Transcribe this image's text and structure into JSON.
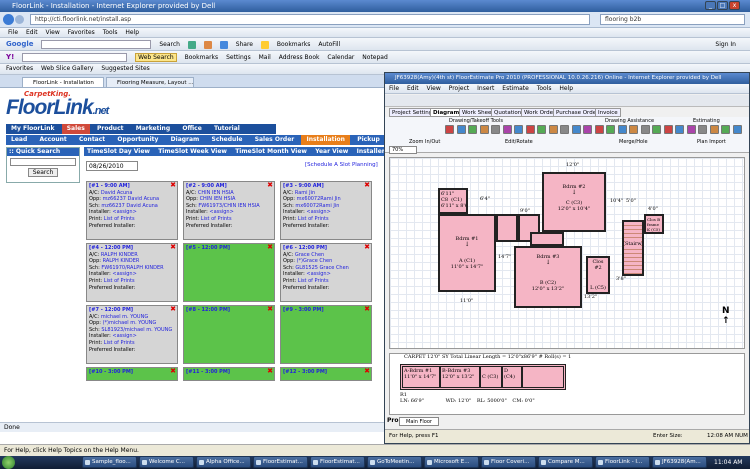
{
  "ie": {
    "title": "FloorLink - Installation - Internet Explorer provided by Dell",
    "url": "http://cti.floorlink.net/install.asp",
    "search_box": "flooring b2b",
    "menu": [
      "File",
      "Edit",
      "View",
      "Favorites",
      "Tools",
      "Help"
    ],
    "google_bar": {
      "logo": "Google",
      "search": "Search",
      "share": "Share",
      "bookmarks": "Bookmarks",
      "autofill": "AutoFill",
      "sign_in": "Sign In"
    },
    "yahoo_bar": {
      "web_search": "Web Search",
      "bookmarks": "Bookmarks",
      "settings": "Settings",
      "mail": "Mail",
      "address_book": "Address Book",
      "calendar": "Calendar",
      "notepad": "Notepad"
    },
    "fav_bar": {
      "favorites": "Favorites",
      "gallery": "Web Slice Gallery",
      "suggested": "Suggested Sites"
    },
    "tabs": [
      "FloorLink - Installation",
      "Flooring Measure, Layout ..."
    ],
    "status": "Done",
    "help": "For Help, click Help Topics on the Help Menu."
  },
  "floorlink": {
    "logo_top": "CarpetKing.",
    "logo_main": "FloorLink",
    "logo_suffix": ".net",
    "nav1": [
      "My FloorLink",
      "Sales",
      "Product",
      "Marketing",
      "Office",
      "Tutorial"
    ],
    "nav2": [
      "Lead",
      "Account",
      "Contact",
      "Opportunity",
      "Diagram",
      "Schedule",
      "Sales Order",
      "Installation",
      "Pickup",
      "Phone Log"
    ],
    "quick_search": "Quick Search",
    "search_button": "Search",
    "views": [
      "TimeSlot Day View",
      "TimeSlot Week View",
      "TimeSlot Month View",
      "Year View",
      "Installer"
    ],
    "date": "08/26/2010",
    "schedule_link": "[Schedule A Slot Planning]",
    "labels": {
      "ac": "A/C:",
      "opp": "Opp:",
      "sch": "Sch:",
      "installer": "Installer:",
      "assign": "<assign>",
      "print": "Print:",
      "print_value": "List of Prints",
      "preferred": "Preferred Installer:"
    },
    "slots": [
      {
        "head": "[#1 - 9:00 AM]",
        "ac": "David Acuna",
        "opp": "mz66237 David Acuna",
        "sch": "mz66237 David Acuna",
        "filled": true
      },
      {
        "head": "[#2 - 9:00 AM]",
        "ac": "CHIN IEN HSIA",
        "opp": "CHIN IEN HSIA",
        "sch": "FW61973/CHIN IEN HSIA",
        "filled": true
      },
      {
        "head": "[#3 - 9:00 AM]",
        "ac": "Rami Jin",
        "opp": "mx60072Rami Jin",
        "sch": "mx60072Rami Jin",
        "filled": true
      },
      {
        "head": "[#4 - 12:00 PM]",
        "ac": "RALPH KINDER",
        "opp": "RALPH KINDER",
        "sch": "FW61970/RALPH KINDER",
        "filled": true
      },
      {
        "head": "[#5 - 12:00 PM]",
        "filled": false
      },
      {
        "head": "[#6 - 12:00 PM]",
        "ac": "Grace Chen",
        "opp": "(*)Grace Chen",
        "sch": "GL81525 Grace Chen",
        "filled": true
      },
      {
        "head": "[#7 - 12:00 PM]",
        "ac": "michael m. YOUNG",
        "opp": "(*)michael m. YOUNG",
        "sch": "SL81923/michael m. YOUNG",
        "filled": true
      },
      {
        "head": "[#8 - 12:00 PM]",
        "filled": false
      },
      {
        "head": "[#9 - 3:00 PM]",
        "filled": false
      },
      {
        "head": "[#10 - 3:00 PM]",
        "filled": false
      },
      {
        "head": "[#11 - 3:00 PM]",
        "filled": false
      },
      {
        "head": "[#12 - 3:00 PM]",
        "filled": false
      }
    ]
  },
  "fe": {
    "title": "JF63928(Amy)(4th st) FloorEstimate Pro 2010 (PROFESSIONAL 10.0.26.216) Online - Internet Explorer provided by Dell",
    "menu": [
      "File",
      "Edit",
      "View",
      "Project",
      "Insert",
      "Estimate",
      "Tools",
      "Help"
    ],
    "tabs": [
      "Project Setting",
      "Diagram",
      "Work Sheet",
      "Quotation",
      "Work Order",
      "Purchase Order",
      "Invoice"
    ],
    "groups": [
      "Drawing/Takeoff Tools",
      "Drawing Assistance",
      "Estimating",
      "Zoom In/Out",
      "Edit/Rotate",
      "Merge/Hole",
      "Plan Import"
    ],
    "zoom": "70%",
    "carpet_line": "CARPET  12'0\"  SY   Total Linear Length = 12'0\"x86'9\"  # Roll(s) = 1",
    "bottom_tab": "Main Floor",
    "pro": "Pro",
    "status": "For Help, press F1",
    "status_size": "Enter Size:",
    "caps": "12:08 AM",
    "num": "NUM",
    "rooms": [
      {
        "label": "6'11\"",
        "sub": "C8  (C1)\n6'11\" x 8'6\""
      },
      {
        "label": "Bdrm #1",
        "sub": "A (C1)\n11'0\" x 14'7\""
      },
      {
        "label": "Bdrm #2",
        "sub": "C (C3)\n12'0\" x 10'4\""
      },
      {
        "label": "Bdrm #3",
        "sub": "B (C2)\n12'0\" x 13'2\""
      },
      {
        "label": "Clos #2",
        "sub": "L (C5)"
      },
      {
        "label": "Stairway1",
        "sub": ""
      },
      {
        "label": "Clos B frame",
        "sub": "K (C5)"
      }
    ],
    "dims": [
      "12'0\"",
      "10'4\"",
      "11'0\"",
      "14'7\"",
      "13'2\"",
      "9'0\"",
      "6'4\"",
      "4'0\"",
      "3'8\"",
      "5'0\""
    ],
    "strip_labels": [
      "A-Bdrm #1\n11'0\" x 14'7\"",
      "B-Bdrm #3\n12'0\" x 13'2\"",
      "C (C3)",
      "D (C4)",
      "R1",
      "LN: 66'9\"",
      "WD: 12'0\"",
      "RL: 5000'0\"",
      "CM: 0'0\""
    ]
  },
  "taskbar": {
    "items": [
      "Sample_floo...",
      "Welcome C...",
      "Alpha Office...",
      "FloorEstimat...",
      "FloorEstimat...",
      "GoToMeetin...",
      "Microsoft E...",
      "Floor Coveri...",
      "Compare M...",
      "FloorLink - I...",
      "JF63928(Am..."
    ],
    "time": "11:04 AM"
  }
}
